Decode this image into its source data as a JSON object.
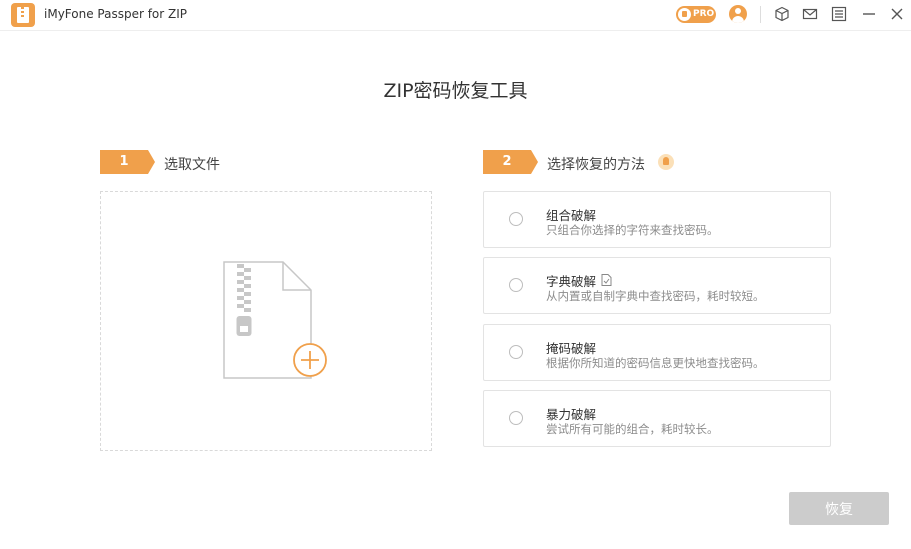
{
  "titlebar": {
    "title": "iMyFone Passper for ZIP",
    "pro_label": "PRO",
    "icons": [
      "app-logo",
      "pro-badge",
      "user-icon",
      "cube-icon",
      "mail-icon",
      "menu-icon",
      "minimize-icon",
      "close-icon"
    ]
  },
  "main": {
    "title": "ZIP密码恢复工具"
  },
  "step1": {
    "number": "1",
    "label": "选取文件"
  },
  "step2": {
    "number": "2",
    "label": "选择恢复的方法"
  },
  "options": [
    {
      "title": "组合破解",
      "desc": "只组合你选择的字符来查找密码。"
    },
    {
      "title": "字典破解",
      "desc": "从内置或自制字典中查找密码，耗时较短。"
    },
    {
      "title": "掩码破解",
      "desc": "根据你所知道的密码信息更快地查找密码。"
    },
    {
      "title": "暴力破解",
      "desc": "尝试所有可能的组合，耗时较长。"
    }
  ],
  "recover_button": {
    "label": "恢复"
  },
  "colors": {
    "accent": "#f0a04b",
    "disabled": "#cccccc",
    "border": "#e3e3e3"
  }
}
